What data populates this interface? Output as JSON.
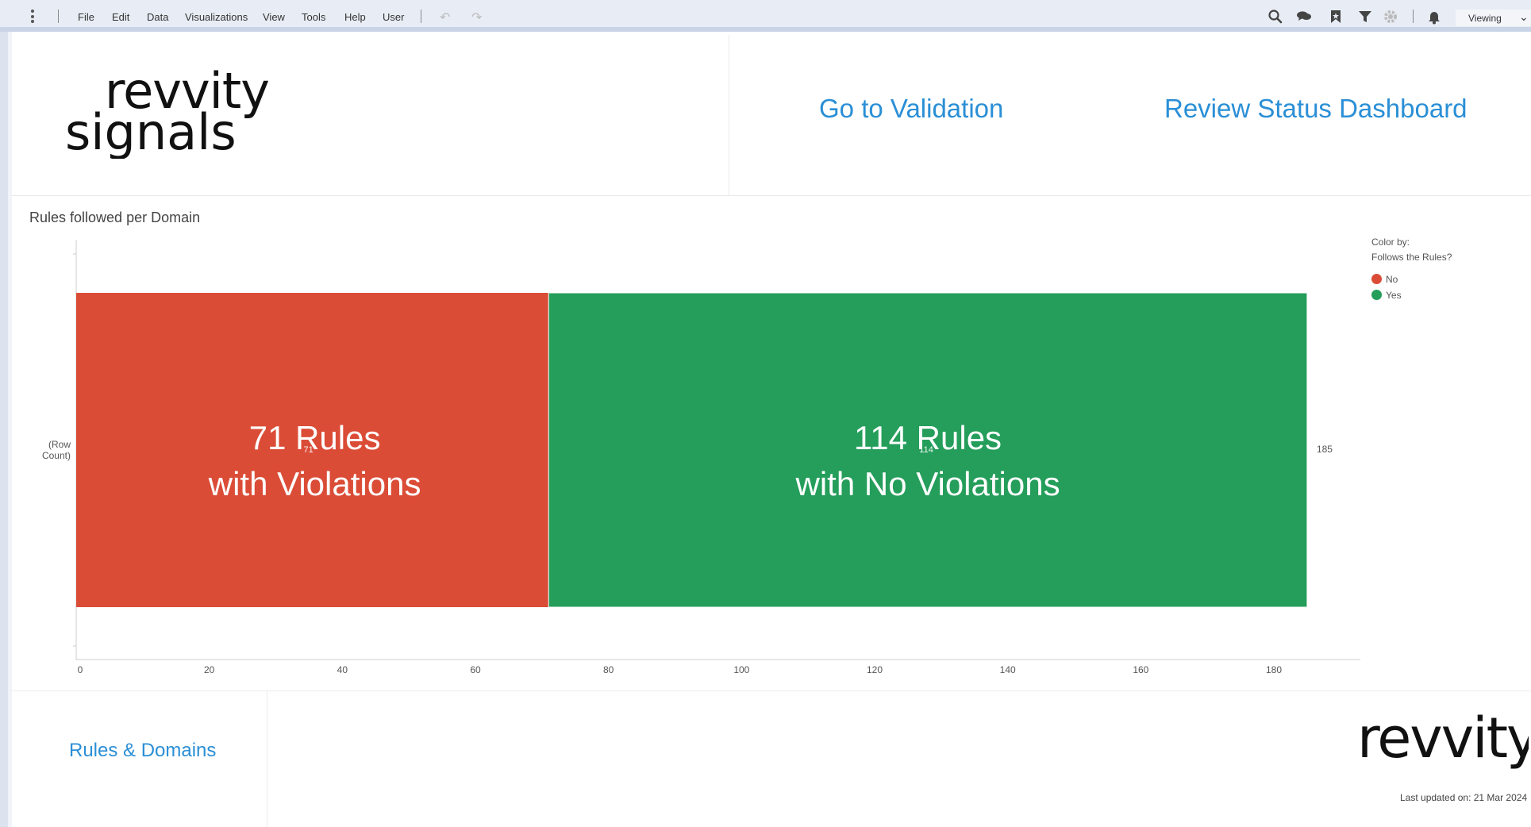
{
  "toolbar": {
    "menu": [
      "File",
      "Edit",
      "Data",
      "Visualizations",
      "View",
      "Tools",
      "Help",
      "User"
    ],
    "icons": [
      "search-icon",
      "comments-icon",
      "bookmark-icon",
      "filter-icon",
      "settings-icon",
      "bell-icon"
    ],
    "mode": "Viewing"
  },
  "header": {
    "logo_top": "revvity",
    "logo_bottom": "signals",
    "link_validation": "Go to Validation",
    "link_review": "Review Status Dashboard"
  },
  "chart_title": "Rules followed per Domain",
  "chart_data": {
    "type": "bar",
    "orientation": "horizontal",
    "stacked": true,
    "title": "Rules followed per Domain",
    "ylabel": "(Row Count)",
    "category_label_line1": "(Row",
    "category_label_line2": "Count)",
    "series": [
      {
        "name": "No",
        "value": 71,
        "color": "#db4c37",
        "label_line1": "71 Rules",
        "label_line2": "with Violations",
        "small_label": "71"
      },
      {
        "name": "Yes",
        "value": 114,
        "color": "#249e5a",
        "label_line1": "114 Rules",
        "label_line2": "with No Violations",
        "small_label": "114"
      }
    ],
    "total_label": "185",
    "x_ticks": [
      "0",
      "20",
      "40",
      "60",
      "80",
      "100",
      "120",
      "140",
      "160",
      "180"
    ],
    "xlim": [
      0,
      193
    ],
    "legend": {
      "title_line1": "Color by:",
      "title_line2": "Follows the Rules?",
      "position": "top-right",
      "items": [
        {
          "label": "No",
          "color": "#db4c37"
        },
        {
          "label": "Yes",
          "color": "#249e5a"
        }
      ]
    }
  },
  "footer": {
    "rules_link": "Rules & Domains",
    "logo": "revvity",
    "last_updated": "Last updated on: 21 Mar 2024"
  }
}
